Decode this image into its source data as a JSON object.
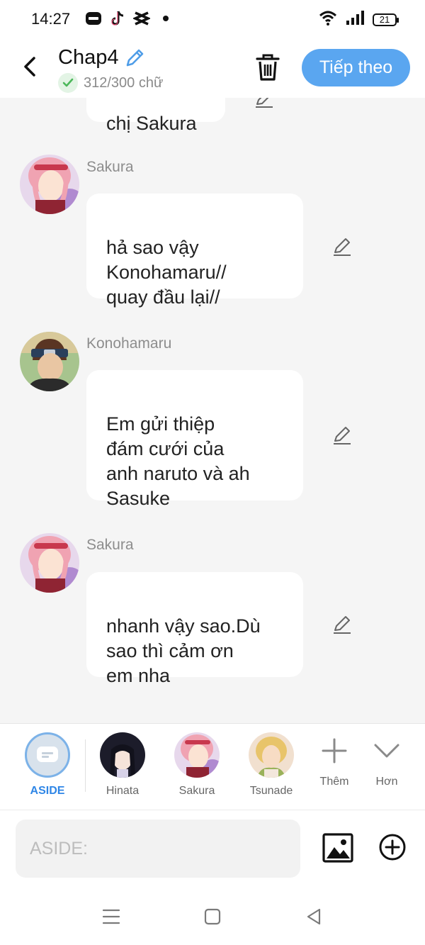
{
  "status": {
    "time": "14:27",
    "battery": "21",
    "app_icons": [
      "zalo-icon",
      "tiktok-icon",
      "capcut-icon",
      "dot-icon"
    ]
  },
  "header": {
    "title": "Chap4",
    "word_count": "312/300 chữ",
    "next_label": "Tiếp theo"
  },
  "messages": [
    {
      "speaker": "",
      "text": "chị Sakura"
    },
    {
      "speaker": "Sakura",
      "text": "hả sao vậy\nKonohamaru//\nquay đầu lại//"
    },
    {
      "speaker": "Konohamaru",
      "text": "Em gửi thiệp\nđám cưới của\nanh naruto và ah\nSasuke"
    },
    {
      "speaker": "Sakura",
      "text": "nhanh vậy sao.Dù\nsao thì  cảm ơn\nem nha"
    }
  ],
  "characters": [
    {
      "name": "ASIDE"
    },
    {
      "name": "Hinata"
    },
    {
      "name": "Sakura"
    },
    {
      "name": "Tsunade"
    }
  ],
  "toolbar": {
    "add_label": "Thêm",
    "more_label": "Hơn"
  },
  "composer": {
    "placeholder": "ASIDE:"
  },
  "colors": {
    "accent": "#5aa6f0",
    "aside_label": "#2f86e6",
    "background": "#f5f5f5"
  }
}
